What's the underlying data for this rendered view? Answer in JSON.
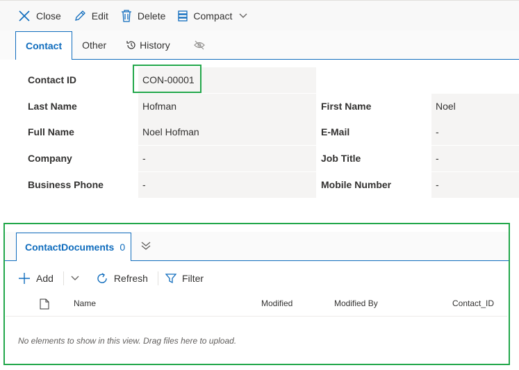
{
  "toolbar": {
    "close_label": "Close",
    "edit_label": "Edit",
    "delete_label": "Delete",
    "compact_label": "Compact"
  },
  "tabs": [
    {
      "label": "Contact",
      "active": true
    },
    {
      "label": "Other",
      "active": false
    },
    {
      "label": "History",
      "active": false
    }
  ],
  "fields": {
    "contact_id": {
      "label": "Contact ID",
      "value": "CON-00001"
    },
    "last_name": {
      "label": "Last Name",
      "value": "Hofman"
    },
    "first_name": {
      "label": "First Name",
      "value": "Noel"
    },
    "full_name": {
      "label": "Full Name",
      "value": "Noel Hofman"
    },
    "email": {
      "label": "E-Mail",
      "value": "-"
    },
    "company": {
      "label": "Company",
      "value": "-"
    },
    "job_title": {
      "label": "Job Title",
      "value": "-"
    },
    "business_phone": {
      "label": "Business Phone",
      "value": "-"
    },
    "mobile_number": {
      "label": "Mobile Number",
      "value": "-"
    }
  },
  "documents": {
    "tab_label": "ContactDocuments",
    "count": "0",
    "toolbar": {
      "add_label": "Add",
      "refresh_label": "Refresh",
      "filter_label": "Filter"
    },
    "columns": [
      "Name",
      "Modified",
      "Modified By",
      "Contact_ID"
    ],
    "empty_message": "No elements to show in this view. Drag files here to upload."
  },
  "colors": {
    "accent": "#0f6cbd",
    "highlight": "#22a74a"
  }
}
